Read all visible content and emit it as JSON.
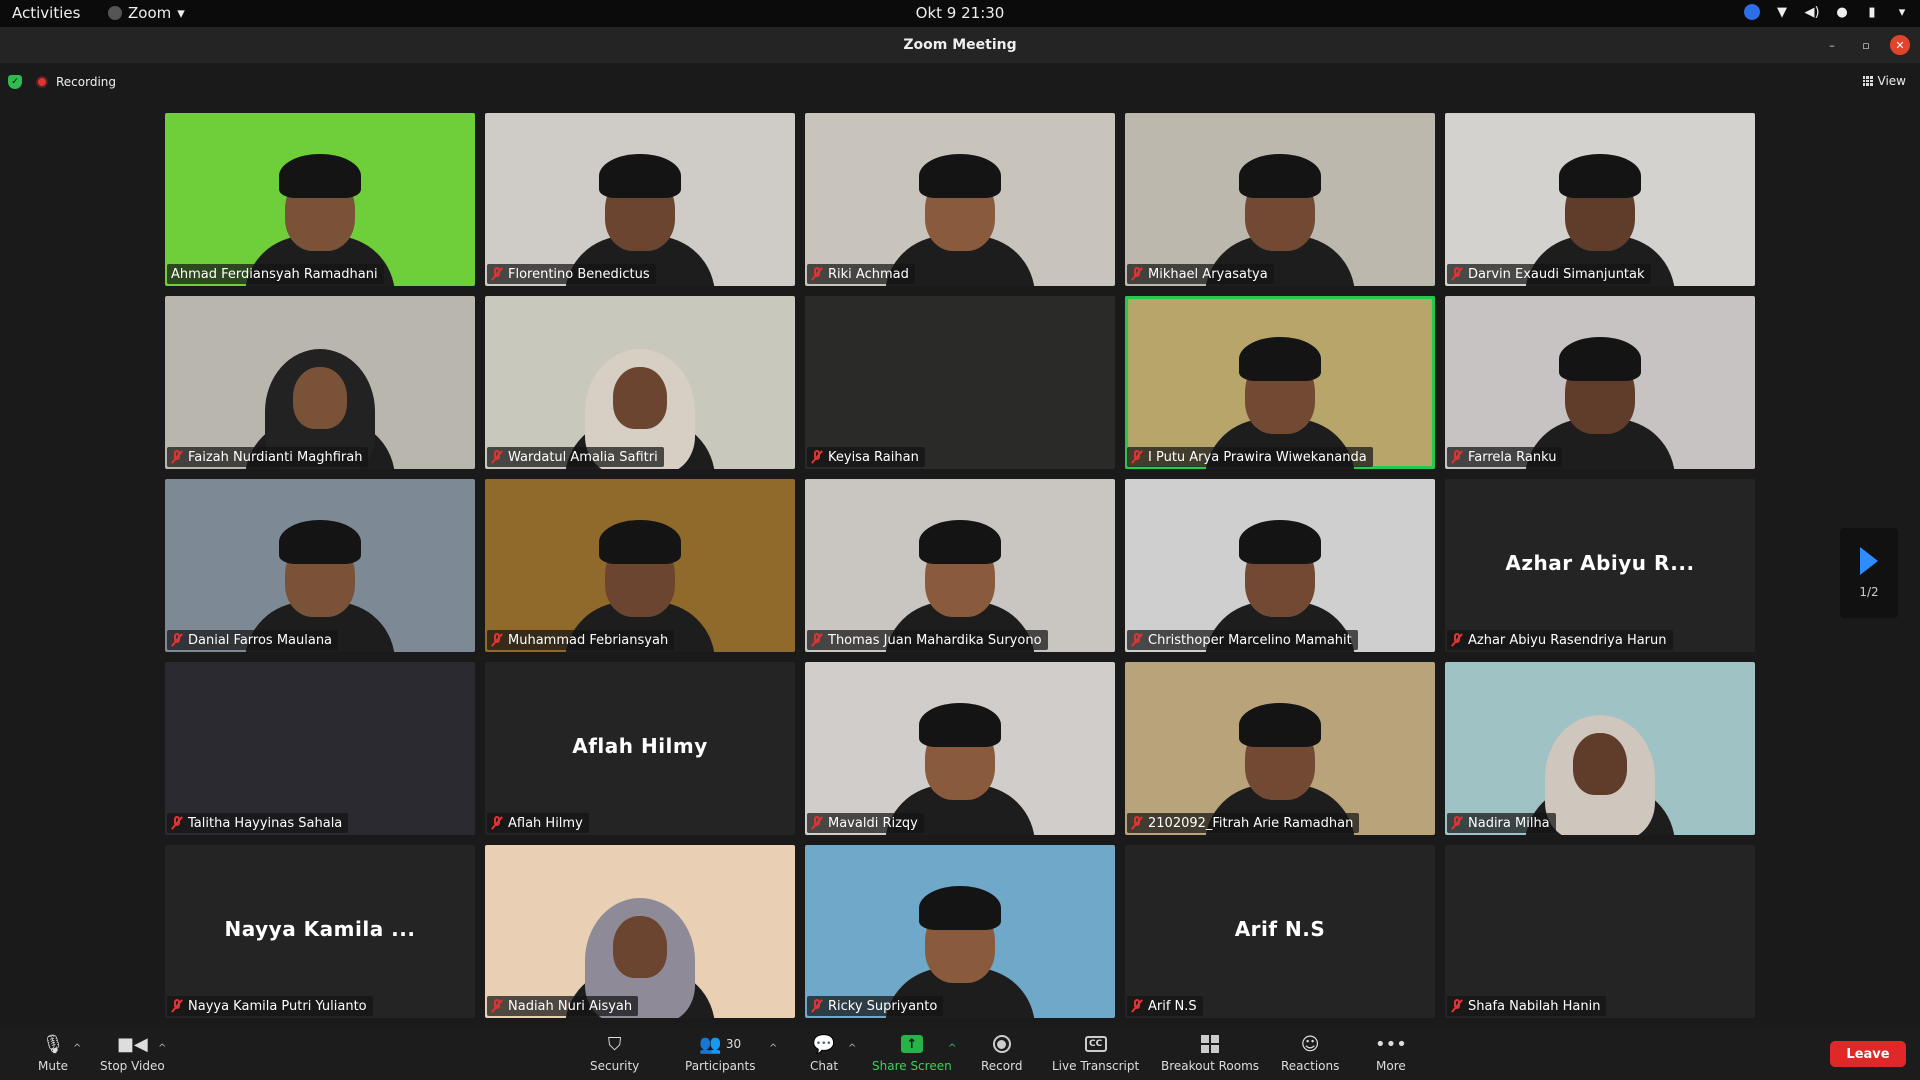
{
  "topbar": {
    "activities": "Activities",
    "app_name": "Zoom",
    "clock": "Okt 9  21:30"
  },
  "window": {
    "title": "Zoom Meeting"
  },
  "meeting": {
    "recording_label": "Recording",
    "view_label": "View",
    "page_indicator": "1/2"
  },
  "participants": [
    {
      "name": "Ahmad Ferdiansyah Ramadhani",
      "video": true,
      "muted": false,
      "bg": "#6fcf3a"
    },
    {
      "name": "Florentino Benedictus",
      "video": true,
      "muted": true,
      "bg": "#cfcbc6"
    },
    {
      "name": "Riki Achmad",
      "video": true,
      "muted": true,
      "bg": "#c9c4bb"
    },
    {
      "name": "Mikhael Aryasatya",
      "video": true,
      "muted": true,
      "bg": "#bdb8ae"
    },
    {
      "name": "Darvin Exaudi Simanjuntak",
      "video": true,
      "muted": true,
      "bg": "#d4d2cf"
    },
    {
      "name": "Faizah Nurdianti Maghfirah",
      "video": true,
      "muted": true,
      "bg": "#b9b6ad"
    },
    {
      "name": "Wardatul Amalia Safitri",
      "video": true,
      "muted": true,
      "bg": "#c8c8bd"
    },
    {
      "name": "Keyisa Raihan",
      "video": true,
      "muted": true,
      "bg": "#2a2a28"
    },
    {
      "name": "I Putu Arya Prawira Wiwekananda",
      "video": true,
      "muted": true,
      "bg": "#b8a56a"
    },
    {
      "name": "Farrela Ranku",
      "video": true,
      "muted": true,
      "bg": "#c6c3c2"
    },
    {
      "name": "Danial Farros Maulana",
      "video": true,
      "muted": true,
      "bg": "#7d8a96"
    },
    {
      "name": "Muhammad Febriansyah",
      "video": true,
      "muted": true,
      "bg": "#8f6a2a"
    },
    {
      "name": "Thomas Juan Mahardika Suryono",
      "video": true,
      "muted": true,
      "bg": "#c9c6c1"
    },
    {
      "name": "Christhoper Marcelino Mamahit",
      "video": true,
      "muted": true,
      "bg": "#cfcfd0"
    },
    {
      "name": "Azhar Abiyu Rasendriya Harun",
      "video": false,
      "muted": true,
      "display_name": "Azhar Abiyu R..."
    },
    {
      "name": "Talitha Hayyinas Sahala",
      "video": true,
      "muted": true,
      "bg": "#2b2a30"
    },
    {
      "name": "Aflah Hilmy",
      "video": false,
      "muted": true,
      "display_name": "Aflah Hilmy"
    },
    {
      "name": "Mavaldi Rizqy",
      "video": true,
      "muted": true,
      "bg": "#d0cdca"
    },
    {
      "name": "2102092_Fitrah Arie Ramadhan",
      "video": true,
      "muted": true,
      "bg": "#b9a37a"
    },
    {
      "name": "Nadira Milha",
      "video": true,
      "muted": true,
      "bg": "#9fc2c4"
    },
    {
      "name": "Nayya Kamila Putri Yulianto",
      "video": false,
      "muted": true,
      "display_name": "Nayya Kamila ..."
    },
    {
      "name": "Nadiah Nuri Aisyah",
      "video": true,
      "muted": true,
      "bg": "#e9d0b4"
    },
    {
      "name": "Ricky Supriyanto",
      "video": true,
      "muted": true,
      "bg": "#6fa8c9"
    },
    {
      "name": "Arif N.S",
      "video": false,
      "muted": true,
      "display_name": "Arif N.S"
    },
    {
      "name": "Shafa Nabilah Hanin",
      "video": false,
      "muted": true,
      "display_name": ""
    }
  ],
  "toolbar": {
    "mute": "Mute",
    "stop_video": "Stop Video",
    "security": "Security",
    "participants": "Participants",
    "participant_count": "30",
    "chat": "Chat",
    "share_screen": "Share Screen",
    "record": "Record",
    "live_transcript": "Live Transcript",
    "breakout_rooms": "Breakout Rooms",
    "reactions": "Reactions",
    "more": "More",
    "leave": "Leave"
  },
  "colors": {
    "active_speaker": "#27c94c",
    "leave": "#e02828",
    "share": "#27b34a",
    "muted": "#e03434",
    "page_arrow": "#2d8cff"
  }
}
